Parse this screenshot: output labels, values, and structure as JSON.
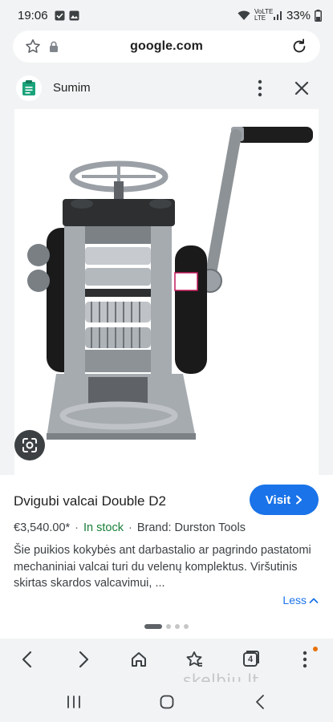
{
  "status_bar": {
    "time": "19:06",
    "battery": "33%",
    "network": "VoLTE LTE"
  },
  "address_bar": {
    "url": "google.com"
  },
  "lens_header": {
    "app_name": "Sumim"
  },
  "result": {
    "title": "Dvigubi valcai Double D2",
    "visit_label": "Visit",
    "price": "€3,540.00*",
    "stock": "In stock",
    "brand": "Brand: Durston Tools",
    "description": "Šie puikios kokybės ant darbastalio ar pagrindo pastatomi mechaniniai valcai turi du velenų komplektus. Viršutinis skirtas skardos valcavimui, ...",
    "less_label": "Less"
  },
  "carousel": {
    "total": 4,
    "active": 0
  },
  "toolbar": {
    "tab_count": "4"
  },
  "watermark": "skelbiu.lt",
  "icons": {
    "star": "star-outline-icon",
    "lock": "lock-icon",
    "reload": "reload-icon",
    "more": "more-vert-icon",
    "close": "close-icon",
    "lens": "google-lens-icon",
    "back": "back-icon",
    "forward": "forward-icon",
    "home": "home-icon",
    "bookmark": "bookmark-star-icon",
    "tabs": "tabs-icon",
    "menu": "menu-icon"
  },
  "colors": {
    "accent": "#1a73e8",
    "stock": "#188038",
    "chrome_bg": "#f1f3f4"
  }
}
